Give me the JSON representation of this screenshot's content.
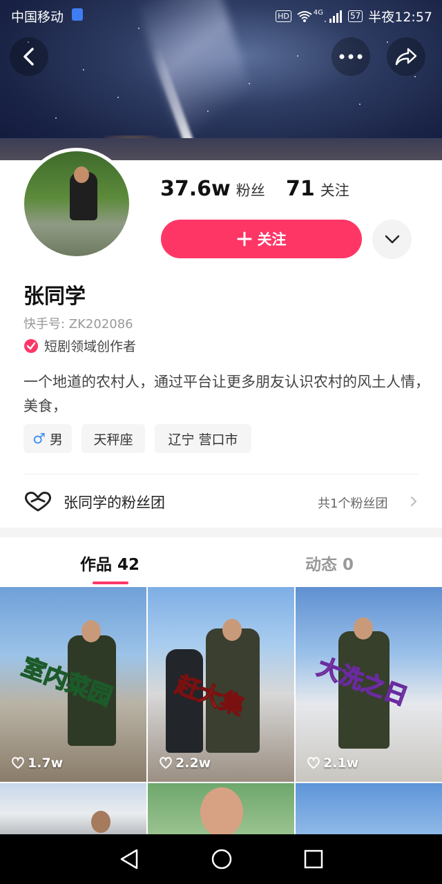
{
  "status_bar": {
    "carrier": "中国移动",
    "hd": "HD",
    "network": "4G",
    "battery": "57",
    "time": "半夜12:57"
  },
  "profile": {
    "fans_count": "37.6w",
    "fans_label": "粉丝",
    "following_count": "71",
    "following_label": "关注",
    "follow_button": "关注",
    "name": "张同学",
    "kuaishou_id": "快手号: ZK202086",
    "certification": "短剧领域创作者",
    "bio": "一个地道的农村人，通过平台让更多朋友认识农村的风土人情，美食，",
    "tags": {
      "gender": "男",
      "zodiac": "天秤座",
      "location": "辽宁 营口市"
    }
  },
  "fan_club": {
    "title": "张同学的粉丝团",
    "count_text": "共1个粉丝团"
  },
  "tabs": {
    "works": "作品 42",
    "moments": "动态 0"
  },
  "videos": [
    {
      "caption": "室内菜园",
      "likes": "1.7w"
    },
    {
      "caption": "赶大集",
      "likes": "2.2w"
    },
    {
      "caption": "大洗之日",
      "likes": "2.1w"
    }
  ],
  "colors": {
    "accent": "#fe3666"
  }
}
